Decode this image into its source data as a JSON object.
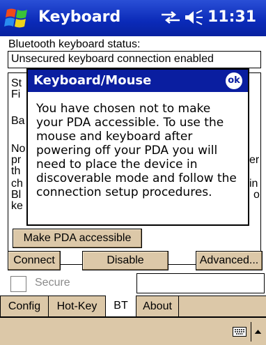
{
  "titlebar": {
    "title": "Keyboard",
    "clock": "11:31"
  },
  "status": {
    "label": "Bluetooth keyboard status:",
    "value": "Unsecured keyboard connection enabled"
  },
  "statusbox": {
    "visible_fragments": [
      "St",
      "Fi",
      "Ba",
      "No",
      "pr",
      "th",
      "ch",
      "Bl",
      "ke",
      "er",
      "in",
      "o"
    ]
  },
  "buttons": {
    "make_accessible": "Make PDA accessible",
    "connect": "Connect",
    "disable": "Disable",
    "advanced": "Advanced..."
  },
  "secure": {
    "label": "Secure",
    "checked": false
  },
  "tabs": [
    {
      "label": "Config",
      "active": false
    },
    {
      "label": "Hot-Key",
      "active": false
    },
    {
      "label": "BT",
      "active": true
    },
    {
      "label": "About",
      "active": false
    }
  ],
  "dialog": {
    "title": "Keyboard/Mouse",
    "ok": "ok",
    "message_lines": [
      "You have chosen not to make",
      "your PDA accessible. To use the",
      "mouse and keyboard after",
      "powering off your PDA you will",
      "need to place the device in",
      "discoverable mode and follow the",
      "connection setup procedures."
    ]
  },
  "colors": {
    "titlebar": "#0a2ab8",
    "dialog_title": "#0a1ea0",
    "button_face": "#dcc8a8"
  },
  "icons": {
    "start": "windows-flag-icon",
    "connectivity": "connectivity-arrows-icon",
    "volume": "speaker-icon",
    "keyboard": "keyboard-icon",
    "input_arrow": "up-arrow-icon"
  }
}
